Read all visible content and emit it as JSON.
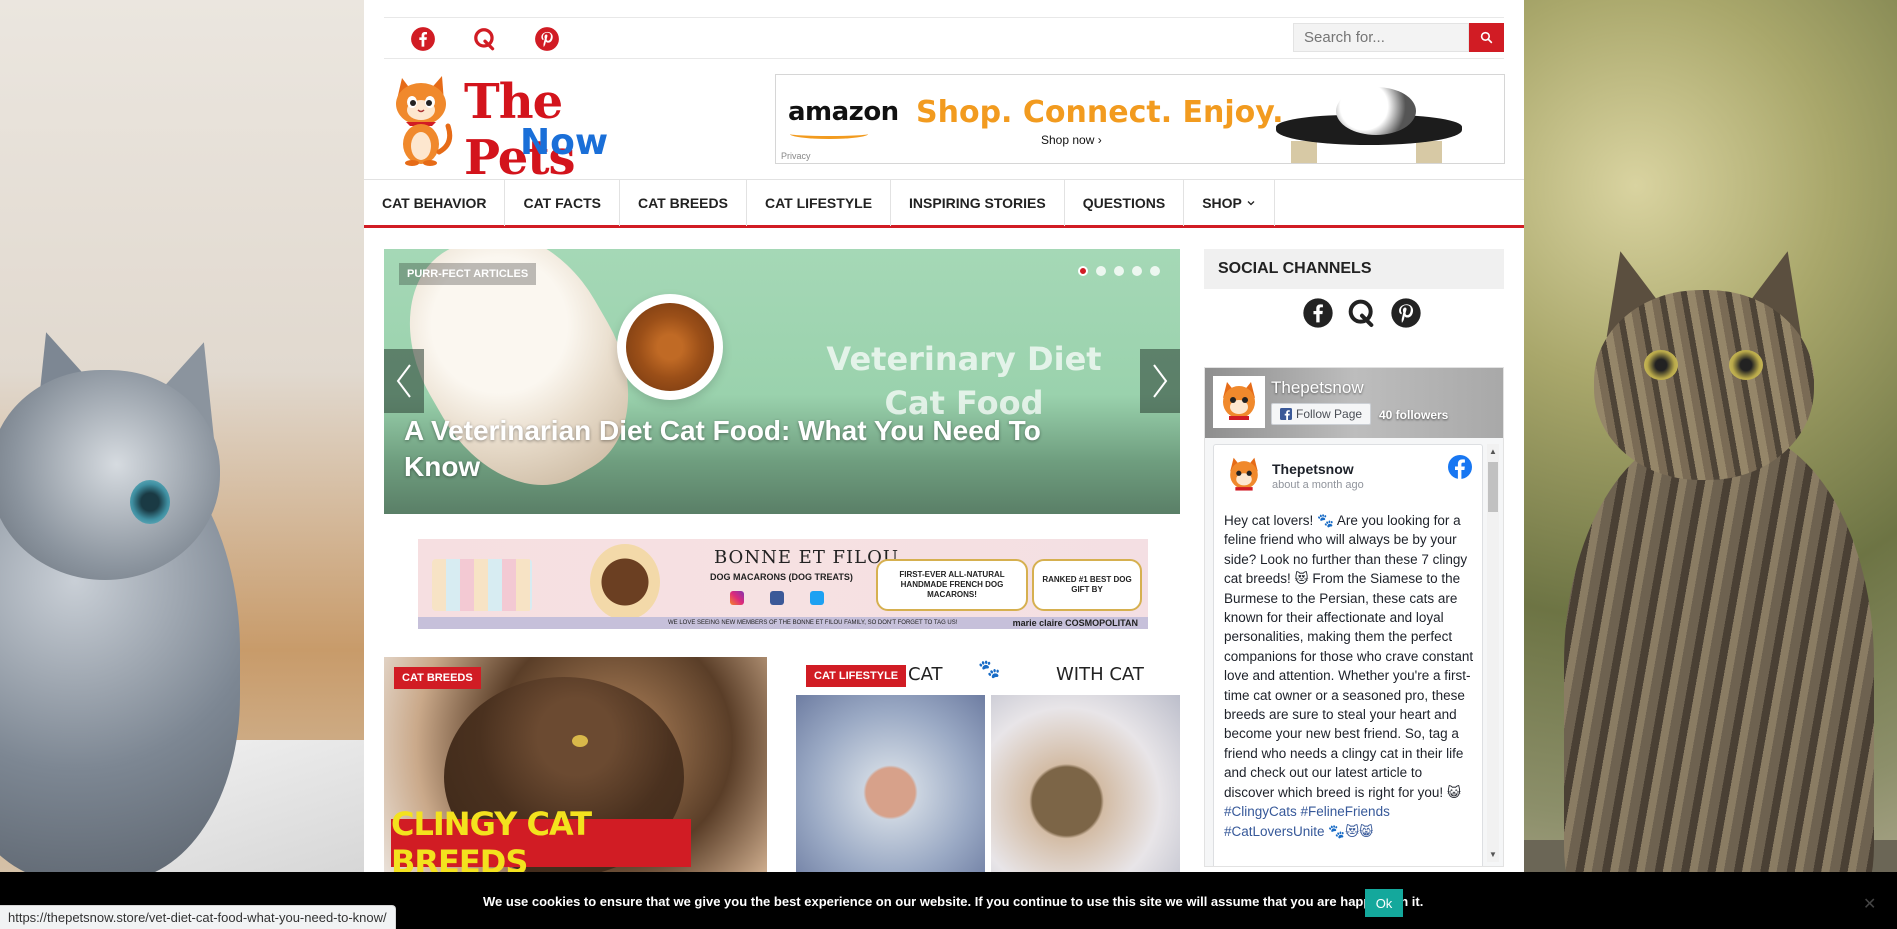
{
  "header": {
    "social_icons": [
      "facebook-icon",
      "quora-icon",
      "pinterest-icon"
    ],
    "search": {
      "placeholder": "Search for..."
    },
    "logo": {
      "line1": "The Pets",
      "line2": "Now"
    }
  },
  "ads": {
    "amazon": {
      "brand": "amazon",
      "tagline": "Shop. Connect. Enjoy.",
      "cta": "Shop now ›",
      "privacy": "Privacy"
    },
    "bonne": {
      "brand": "BONNE ET FILOU",
      "subtitle": "DOG MACARONS (DOG TREATS)",
      "box1": "FIRST-EVER ALL-NATURAL HANDMADE FRENCH DOG MACARONS!",
      "box2": "RANKED #1 BEST DOG GIFT BY",
      "strip": "WE LOVE SEEING NEW MEMBERS OF THE BONNE ET FILOU FAMILY, SO DON'T FORGET TO TAG US!",
      "mags": "marie claire  COSMOPOLITAN"
    }
  },
  "nav": {
    "items": [
      "CAT BEHAVIOR",
      "CAT FACTS",
      "CAT BREEDS",
      "CAT LIFESTYLE",
      "INSPIRING STORIES",
      "QUESTIONS",
      "SHOP"
    ]
  },
  "slider": {
    "category": "PURR-FECT ARTICLES",
    "background_text": "Veterinary Diet Cat Food",
    "title": "A Veterinarian Diet Cat Food: What You Need To Know",
    "dot_count": 5,
    "active_dot": 0
  },
  "cards": [
    {
      "category": "CAT BREEDS",
      "image_text": "CLINGY CAT BREEDS"
    },
    {
      "category": "CAT LIFESTYLE",
      "image_text_left": "CAT",
      "image_text_right": "WITH CAT"
    }
  ],
  "sidebar": {
    "heading": "SOCIAL CHANNELS",
    "facebook": {
      "page_name": "Thepetsnow",
      "follow_label": "Follow Page",
      "followers": "40 followers",
      "post": {
        "author": "Thepetsnow",
        "time": "about a month ago",
        "text": "Hey cat lovers! 🐾 Are you looking for a feline friend who will always be by your side? Look no further than these 7 clingy cat breeds! 😻 From the Siamese to the Burmese to the Persian, these cats are known for their affectionate and loyal personalities, making them the perfect companions for those who crave constant love and attention. Whether you're a first-time cat owner or a seasoned pro, these breeds are sure to steal your heart and become your new best friend. So, tag a friend who needs a clingy cat in their life and check out our latest article to discover which breed is right for you! 😺",
        "hashtags": "#ClingyCats #FelineFriends",
        "hashtags2": "#CatLoversUnite 🐾😻😸"
      }
    }
  },
  "cookie": {
    "text": "We use cookies to ensure that we give you the best experience on our website. If you continue to use this site we will assume that you are happy with it.",
    "ok_label": "Ok"
  },
  "status_url": "https://thepetsnow.store/vet-diet-cat-food-what-you-need-to-know/",
  "colors": {
    "accent": "#d11c24",
    "logo_blue": "#1a6fd8",
    "amazon_orange": "#f29b1f",
    "cookie_ok": "#14a89c"
  }
}
